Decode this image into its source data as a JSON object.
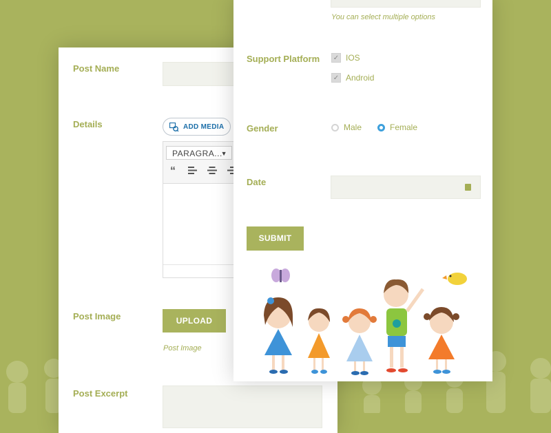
{
  "left_form": {
    "post_name_label": "Post Name",
    "details_label": "Details",
    "add_media_label": "ADD MEDIA",
    "format_select_value": "PARAGRA...",
    "post_image_label": "Post Image",
    "upload_label": "UPLOAD",
    "post_image_hint": "Post Image",
    "post_excerpt_label": "Post Excerpt"
  },
  "right_form": {
    "multi_hint": "You can select multiple options",
    "support_platform_label": "Support Platform",
    "platforms": [
      {
        "label": "IOS",
        "checked": true
      },
      {
        "label": "Android",
        "checked": true
      }
    ],
    "gender_label": "Gender",
    "gender_options": [
      {
        "label": "Male",
        "selected": false
      },
      {
        "label": "Female",
        "selected": true
      }
    ],
    "date_label": "Date",
    "date_value": "",
    "submit_label": "SUBMIT"
  },
  "colors": {
    "background": "#a9b35d",
    "accent": "#a4ae55",
    "radio_selected": "#3ea0dc",
    "link_blue": "#1b6ea8"
  },
  "icons": {
    "quote": "blockquote-icon",
    "align_left": "align-left-icon",
    "align_center": "align-center-icon",
    "align_right": "align-right-icon",
    "media": "add-media-icon",
    "calendar": "calendar-icon"
  }
}
